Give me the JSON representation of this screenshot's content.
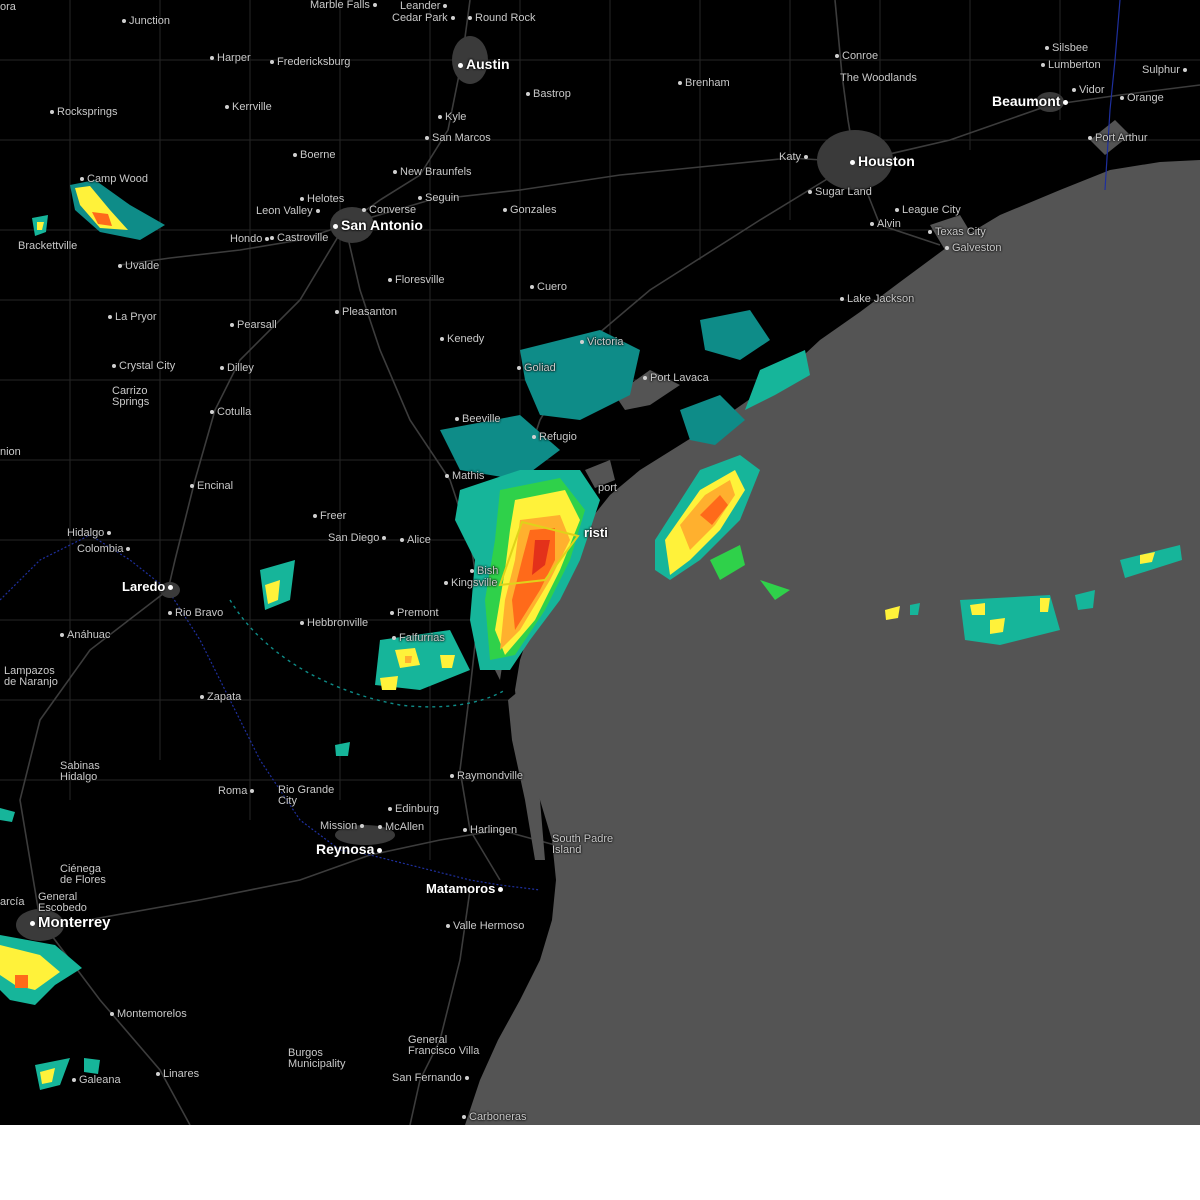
{
  "map": {
    "colors": {
      "land": "#000000",
      "water": "#545454",
      "roads": "#3a3a3a",
      "county_lines": "#262626",
      "border": "#1e2f9e",
      "city_label": "#c9c9c9",
      "major_city_label": "#ffffff",
      "warning_polygon": "#e0d21a",
      "radar_scale": [
        "#0e8c88",
        "#16b59a",
        "#2fd14a",
        "#b6e530",
        "#fff23a",
        "#ffb02e",
        "#ff6a1a",
        "#e3311a"
      ]
    },
    "cities": [
      {
        "id": "ora",
        "label": "ora",
        "major": false
      },
      {
        "id": "marble-falls",
        "label": "Marble Falls",
        "major": false
      },
      {
        "id": "leander",
        "label": "Leander",
        "major": false
      },
      {
        "id": "cedar-park",
        "label": "Cedar Park",
        "major": false
      },
      {
        "id": "round-rock",
        "label": "Round Rock",
        "major": false
      },
      {
        "id": "junction",
        "label": "Junction",
        "major": false
      },
      {
        "id": "harper",
        "label": "Harper",
        "major": false
      },
      {
        "id": "fredericksburg",
        "label": "Fredericksburg",
        "major": false
      },
      {
        "id": "austin",
        "label": "Austin",
        "major": true
      },
      {
        "id": "conroe",
        "label": "Conroe",
        "major": false
      },
      {
        "id": "silsbee",
        "label": "Silsbee",
        "major": false
      },
      {
        "id": "lumberton",
        "label": "Lumberton",
        "major": false
      },
      {
        "id": "sulphur",
        "label": "Sulphur",
        "major": false
      },
      {
        "id": "brenham",
        "label": "Brenham",
        "major": false
      },
      {
        "id": "the-woodlands",
        "label": "The Woodlands",
        "major": false
      },
      {
        "id": "beaumont",
        "label": "Beaumont",
        "major": true
      },
      {
        "id": "vidor",
        "label": "Vidor",
        "major": false
      },
      {
        "id": "orange",
        "label": "Orange",
        "major": false
      },
      {
        "id": "bastrop",
        "label": "Bastrop",
        "major": false
      },
      {
        "id": "rocksprings",
        "label": "Rocksprings",
        "major": false
      },
      {
        "id": "kerrville",
        "label": "Kerrville",
        "major": false
      },
      {
        "id": "kyle",
        "label": "Kyle",
        "major": false
      },
      {
        "id": "port-arthur",
        "label": "Port Arthur",
        "major": false
      },
      {
        "id": "san-marcos",
        "label": "San Marcos",
        "major": false
      },
      {
        "id": "boerne",
        "label": "Boerne",
        "major": false
      },
      {
        "id": "katy",
        "label": "Katy",
        "major": false
      },
      {
        "id": "houston",
        "label": "Houston",
        "major": true
      },
      {
        "id": "new-braunfels",
        "label": "New Braunfels",
        "major": false
      },
      {
        "id": "camp-wood",
        "label": "Camp Wood",
        "major": false
      },
      {
        "id": "sugar-land",
        "label": "Sugar Land",
        "major": false
      },
      {
        "id": "seguin",
        "label": "Seguin",
        "major": false
      },
      {
        "id": "helotes",
        "label": "Helotes",
        "major": false
      },
      {
        "id": "leon-valley",
        "label": "Leon Valley",
        "major": false
      },
      {
        "id": "converse",
        "label": "Converse",
        "major": false
      },
      {
        "id": "gonzales",
        "label": "Gonzales",
        "major": false
      },
      {
        "id": "league-city",
        "label": "League City",
        "major": false
      },
      {
        "id": "san-antonio",
        "label": "San Antonio",
        "major": true
      },
      {
        "id": "alvin",
        "label": "Alvin",
        "major": false
      },
      {
        "id": "hondo",
        "label": "Hondo",
        "major": false
      },
      {
        "id": "castroville",
        "label": "Castroville",
        "major": false
      },
      {
        "id": "texas-city",
        "label": "Texas City",
        "major": false
      },
      {
        "id": "brackettville",
        "label": "Brackettville",
        "major": false
      },
      {
        "id": "galveston",
        "label": "Galveston",
        "major": false
      },
      {
        "id": "uvalde",
        "label": "Uvalde",
        "major": false
      },
      {
        "id": "floresville",
        "label": "Floresville",
        "major": false
      },
      {
        "id": "cuero",
        "label": "Cuero",
        "major": false
      },
      {
        "id": "lake-jackson",
        "label": "Lake Jackson",
        "major": false
      },
      {
        "id": "pleasanton",
        "label": "Pleasanton",
        "major": false
      },
      {
        "id": "la-pryor",
        "label": "La Pryor",
        "major": false
      },
      {
        "id": "pearsall",
        "label": "Pearsall",
        "major": false
      },
      {
        "id": "kenedy",
        "label": "Kenedy",
        "major": false
      },
      {
        "id": "victoria",
        "label": "Victoria",
        "major": false
      },
      {
        "id": "crystal-city",
        "label": "Crystal City",
        "major": false
      },
      {
        "id": "dilley",
        "label": "Dilley",
        "major": false
      },
      {
        "id": "goliad",
        "label": "Goliad",
        "major": false
      },
      {
        "id": "port-lavaca",
        "label": "Port Lavaca",
        "major": false
      },
      {
        "id": "carrizo-springs",
        "label": "Carrizo\nSprings",
        "major": false
      },
      {
        "id": "cotulla",
        "label": "Cotulla",
        "major": false
      },
      {
        "id": "beeville",
        "label": "Beeville",
        "major": false
      },
      {
        "id": "refugio",
        "label": "Refugio",
        "major": false
      },
      {
        "id": "nion",
        "label": "nion",
        "major": false
      },
      {
        "id": "mathis",
        "label": "Mathis",
        "major": false
      },
      {
        "id": "encinal",
        "label": "Encinal",
        "major": false
      },
      {
        "id": "aransas-pass",
        "label": "port",
        "major": false
      },
      {
        "id": "freer",
        "label": "Freer",
        "major": false
      },
      {
        "id": "hidalgo",
        "label": "Hidalgo",
        "major": false
      },
      {
        "id": "san-diego",
        "label": "San Diego",
        "major": false
      },
      {
        "id": "alice",
        "label": "Alice",
        "major": false
      },
      {
        "id": "corpus-christi",
        "label": "risti",
        "major": true
      },
      {
        "id": "colombia",
        "label": "Colombia",
        "major": false
      },
      {
        "id": "bishop",
        "label": "Bish",
        "major": false
      },
      {
        "id": "laredo",
        "label": "Laredo",
        "major": true
      },
      {
        "id": "kingsville",
        "label": "Kingsville",
        "major": false
      },
      {
        "id": "rio-bravo",
        "label": "Rio Bravo",
        "major": false
      },
      {
        "id": "premont",
        "label": "Premont",
        "major": false
      },
      {
        "id": "hebbronville",
        "label": "Hebbronville",
        "major": false
      },
      {
        "id": "anahuac",
        "label": "Anáhuac",
        "major": false
      },
      {
        "id": "falfurrias",
        "label": "Falfurrias",
        "major": false
      },
      {
        "id": "lampazos",
        "label": "Lampazos\nde Naranjo",
        "major": false
      },
      {
        "id": "zapata",
        "label": "Zapata",
        "major": false
      },
      {
        "id": "sabinas-hidalgo",
        "label": "Sabinas\nHidalgo",
        "major": false
      },
      {
        "id": "raymondville",
        "label": "Raymondville",
        "major": false
      },
      {
        "id": "roma",
        "label": "Roma",
        "major": false
      },
      {
        "id": "rio-grande-city",
        "label": "Rio Grande\nCity",
        "major": false
      },
      {
        "id": "edinburg",
        "label": "Edinburg",
        "major": false
      },
      {
        "id": "mission",
        "label": "Mission",
        "major": false
      },
      {
        "id": "mcallen",
        "label": "McAllen",
        "major": false
      },
      {
        "id": "harlingen",
        "label": "Harlingen",
        "major": false
      },
      {
        "id": "south-padre-island",
        "label": "South Padre\nIsland",
        "major": false
      },
      {
        "id": "reynosa",
        "label": "Reynosa",
        "major": true
      },
      {
        "id": "cienega-de-flores",
        "label": "Ciénega\nde Flores",
        "major": false
      },
      {
        "id": "matamoros",
        "label": "Matamoros",
        "major": true
      },
      {
        "id": "general-escobedo",
        "label": "General\nEscobedo",
        "major": false
      },
      {
        "id": "garcia",
        "label": "arcía",
        "major": false
      },
      {
        "id": "monterrey",
        "label": "Monterrey",
        "major": true
      },
      {
        "id": "valle-hermoso",
        "label": "Valle Hermoso",
        "major": false
      },
      {
        "id": "montemorelos",
        "label": "Montemorelos",
        "major": false
      },
      {
        "id": "general-francisco-villa",
        "label": "General\nFrancisco Villa",
        "major": false
      },
      {
        "id": "burgos-municipality",
        "label": "Burgos\nMunicipality",
        "major": false
      },
      {
        "id": "linares",
        "label": "Linares",
        "major": false
      },
      {
        "id": "galeana",
        "label": "Galeana",
        "major": false
      },
      {
        "id": "san-fernando",
        "label": "San Fernando",
        "major": false
      },
      {
        "id": "carboneras",
        "label": "Carboneras",
        "major": false
      }
    ]
  }
}
